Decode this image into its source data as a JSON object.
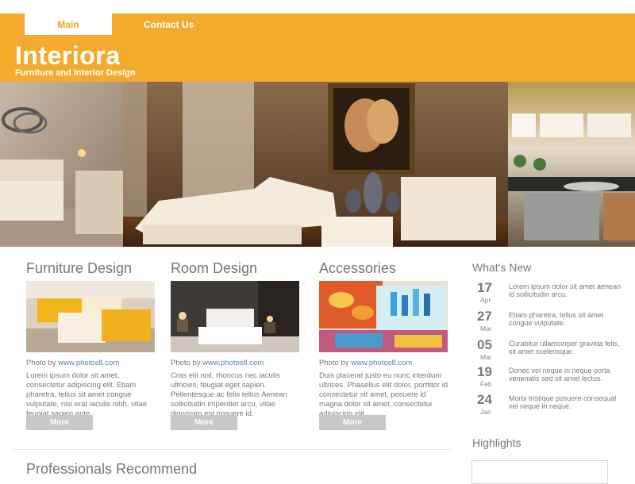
{
  "nav": {
    "main_label": "Main",
    "contact_label": "Contact Us"
  },
  "brand": {
    "title": "Interiora",
    "tagline": "Furniture and Interior Design",
    "accent": "#f4ab2d"
  },
  "columns": [
    {
      "title": "Furniture Design",
      "credit_prefix": "Photo by",
      "credit_link": "www.photos8.com",
      "text": "Lorem ipsum dolor sit amet, consectetur adipiscing elit. Etiam pharetra, tellus sit amet congue vulputate, nisi erat iaculis nibh, vitae feugiat sapien ante.",
      "button": "More"
    },
    {
      "title": "Room Design",
      "credit_prefix": "Photo by",
      "credit_link": "www.photos8.com",
      "text": "Cras elit nisl, rhoncus nec iaculis ultricies, feugiat eget sapien. Pellentesque ac felis tellus Aenean sollicitudin imperdiet arcu, vitae dignissim est posuere id.",
      "button": "More"
    },
    {
      "title": "Accessories",
      "credit_prefix": "Photo by",
      "credit_link": "www.photos8.com",
      "text": "Duis placerat justo eu nunc interdum ultrices. Phasellus elit dolor, porttitor id consectetur sit amet, posuere id magna dolor sit amet, consectetur adipiscing elit.",
      "button": "More"
    }
  ],
  "sidebar": {
    "whats_new_title": "What's New",
    "news": [
      {
        "day": "17",
        "month": "Apr",
        "text": "Lorem ipsum dolor sit amet aenean id sollicitudin arcu."
      },
      {
        "day": "27",
        "month": "Mar",
        "text": "Etiam pharetra, tellus sit amet congue vulputate."
      },
      {
        "day": "05",
        "month": "Mar",
        "text": "Curabitur ullamcorper gravida felis, sit amet scelerisque."
      },
      {
        "day": "19",
        "month": "Feb",
        "text": "Donec vel neque in neque porta venenatis sed sit amet lectus."
      },
      {
        "day": "24",
        "month": "Jan",
        "text": "Morbi tristique posuere consequat vel neque in neque."
      }
    ],
    "highlights_title": "Highlights"
  },
  "bottom": {
    "title": "Professionals Recommend"
  }
}
